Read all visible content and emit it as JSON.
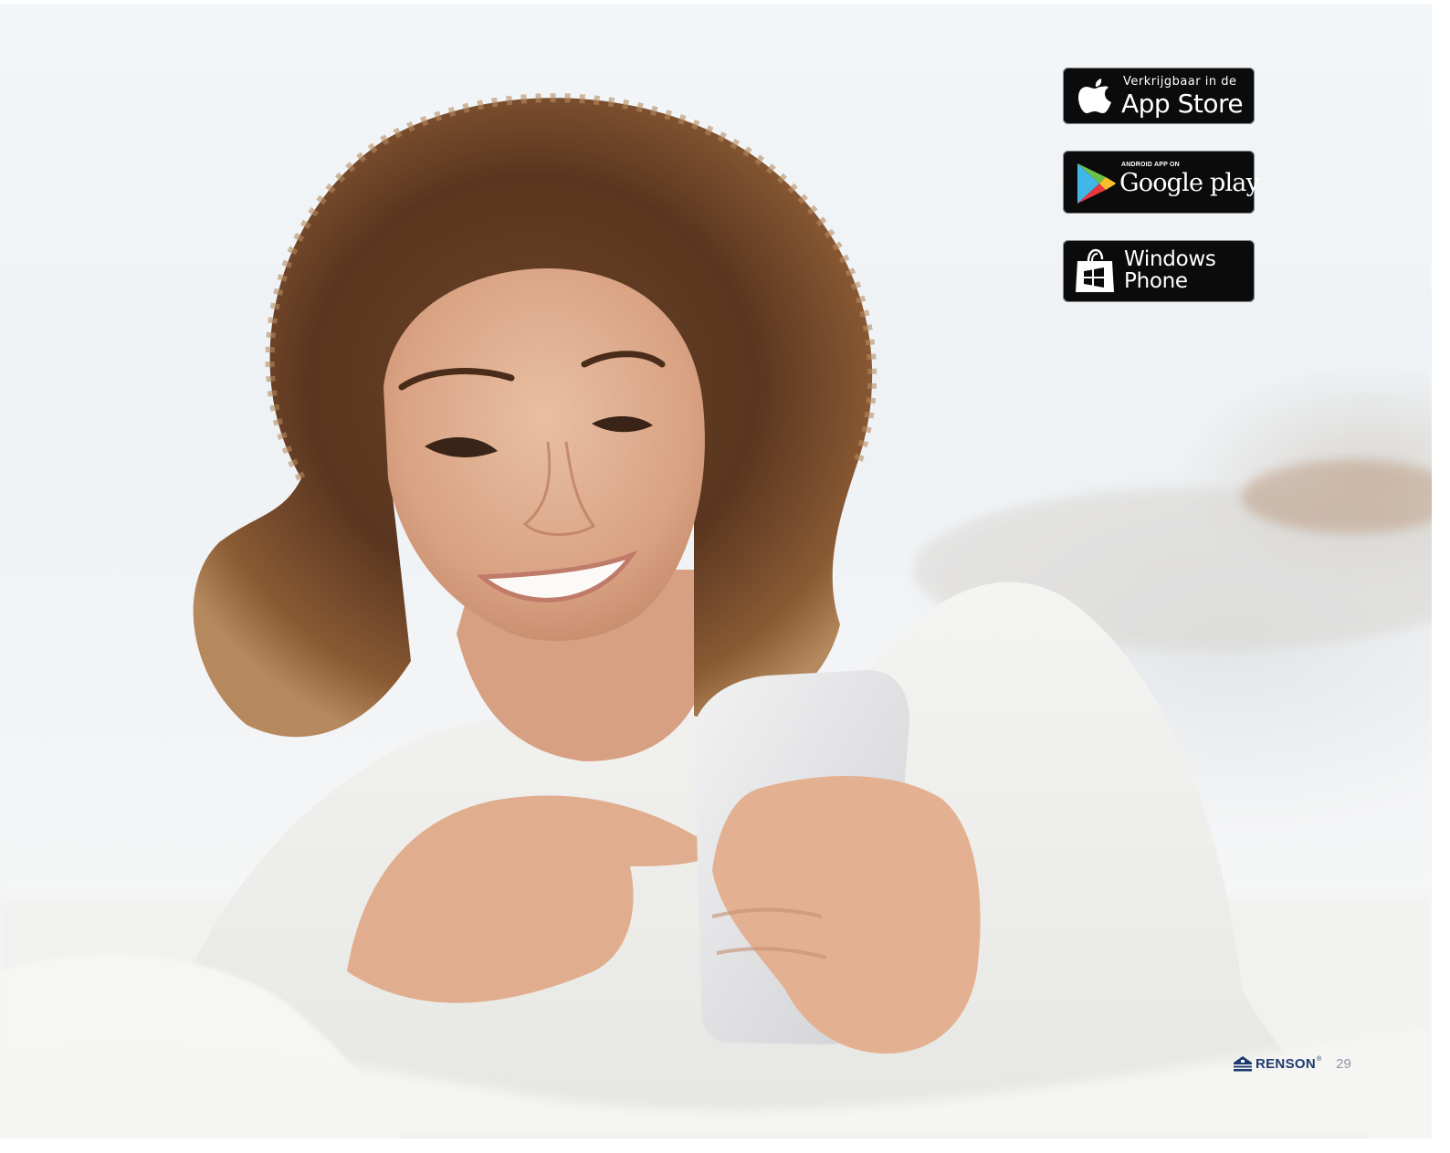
{
  "photo": {
    "subject": "woman-smiling-using-smartphone"
  },
  "badges": {
    "appstore": {
      "small": "Verkrijgbaar in de",
      "big": "App Store",
      "icon": "apple-icon"
    },
    "google": {
      "small": "ANDROID APP ON",
      "big": "Google play",
      "icon": "google-play-icon"
    },
    "windows": {
      "line1": "Windows",
      "line2": "Phone",
      "icon": "windows-store-icon"
    }
  },
  "footer": {
    "brand": "RENSON",
    "registered": "®",
    "page_number": "29"
  },
  "colors": {
    "brand": "#1d3a6e",
    "badge_bg": "#0b0b0b",
    "page_number": "#8d97a8"
  }
}
